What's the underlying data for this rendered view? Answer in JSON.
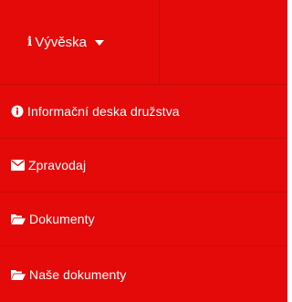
{
  "nav": {
    "menu_label": "Vývěska",
    "menu_icon": "info-icon",
    "accent_color": "#e40a0a",
    "divider_color": "#c80707"
  },
  "dropdown": {
    "items": [
      {
        "label": "Informační deska družstva",
        "icon": "info-circle-icon"
      },
      {
        "label": "Zpravodaj",
        "icon": "envelope-icon"
      },
      {
        "label": "Dokumenty",
        "icon": "folder-open-icon"
      },
      {
        "label": "Naše dokumenty",
        "icon": "folder-open-icon"
      }
    ]
  }
}
